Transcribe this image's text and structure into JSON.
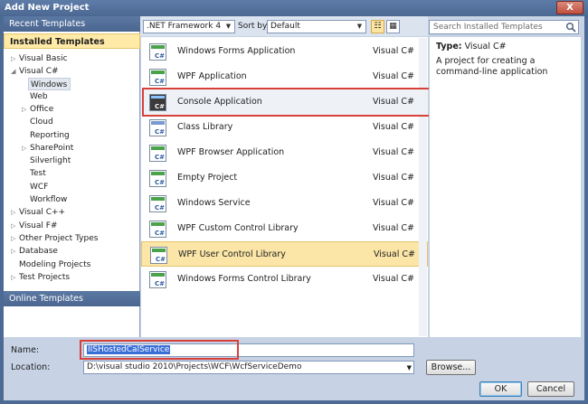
{
  "window": {
    "title": "Add New Project",
    "close_label": "X"
  },
  "left_panel": {
    "recent_templates": "Recent Templates",
    "installed_templates": "Installed Templates",
    "online_templates": "Online Templates",
    "tree": [
      {
        "label": "Visual Basic",
        "arrow": "▷"
      },
      {
        "label": "Visual C#",
        "arrow": "◢"
      },
      {
        "label": "Windows",
        "arrow": ""
      },
      {
        "label": "Web",
        "arrow": ""
      },
      {
        "label": "Office",
        "arrow": "▷"
      },
      {
        "label": "Cloud",
        "arrow": ""
      },
      {
        "label": "Reporting",
        "arrow": ""
      },
      {
        "label": "SharePoint",
        "arrow": "▷"
      },
      {
        "label": "Silverlight",
        "arrow": ""
      },
      {
        "label": "Test",
        "arrow": ""
      },
      {
        "label": "WCF",
        "arrow": ""
      },
      {
        "label": "Workflow",
        "arrow": ""
      },
      {
        "label": "Visual C++",
        "arrow": "▷"
      },
      {
        "label": "Visual F#",
        "arrow": "▷"
      },
      {
        "label": "Other Project Types",
        "arrow": "▷"
      },
      {
        "label": "Database",
        "arrow": "▷"
      },
      {
        "label": "Modeling Projects",
        "arrow": ""
      },
      {
        "label": "Test Projects",
        "arrow": "▷"
      }
    ]
  },
  "toolbar": {
    "framework": ".NET Framework 4",
    "sort_label": "Sort by:",
    "sort_value": "Default"
  },
  "search": {
    "placeholder": "Search Installed Templates"
  },
  "templates": [
    {
      "name": "Windows Forms Application",
      "lang": "Visual C#"
    },
    {
      "name": "WPF Application",
      "lang": "Visual C#"
    },
    {
      "name": "Console Application",
      "lang": "Visual C#"
    },
    {
      "name": "Class Library",
      "lang": "Visual C#"
    },
    {
      "name": "WPF Browser Application",
      "lang": "Visual C#"
    },
    {
      "name": "Empty Project",
      "lang": "Visual C#"
    },
    {
      "name": "Windows Service",
      "lang": "Visual C#"
    },
    {
      "name": "WPF Custom Control Library",
      "lang": "Visual C#"
    },
    {
      "name": "WPF User Control Library",
      "lang": "Visual C#"
    },
    {
      "name": "Windows Forms Control Library",
      "lang": "Visual C#"
    }
  ],
  "details": {
    "type_label": "Type:",
    "type_value": "Visual C#",
    "description": "A project for creating a command-line application"
  },
  "form": {
    "name_label": "Name:",
    "name_value": "IISHostedCalService",
    "location_label": "Location:",
    "location_value": "D:\\visual studio 2010\\Projects\\WCF\\WcfServiceDemo",
    "browse_label": "Browse...",
    "ok_label": "OK",
    "cancel_label": "Cancel"
  },
  "colors": {
    "selection": "#fbe6a8",
    "annotation_red": "#d8403a",
    "header_blue": "#5c79a3"
  }
}
